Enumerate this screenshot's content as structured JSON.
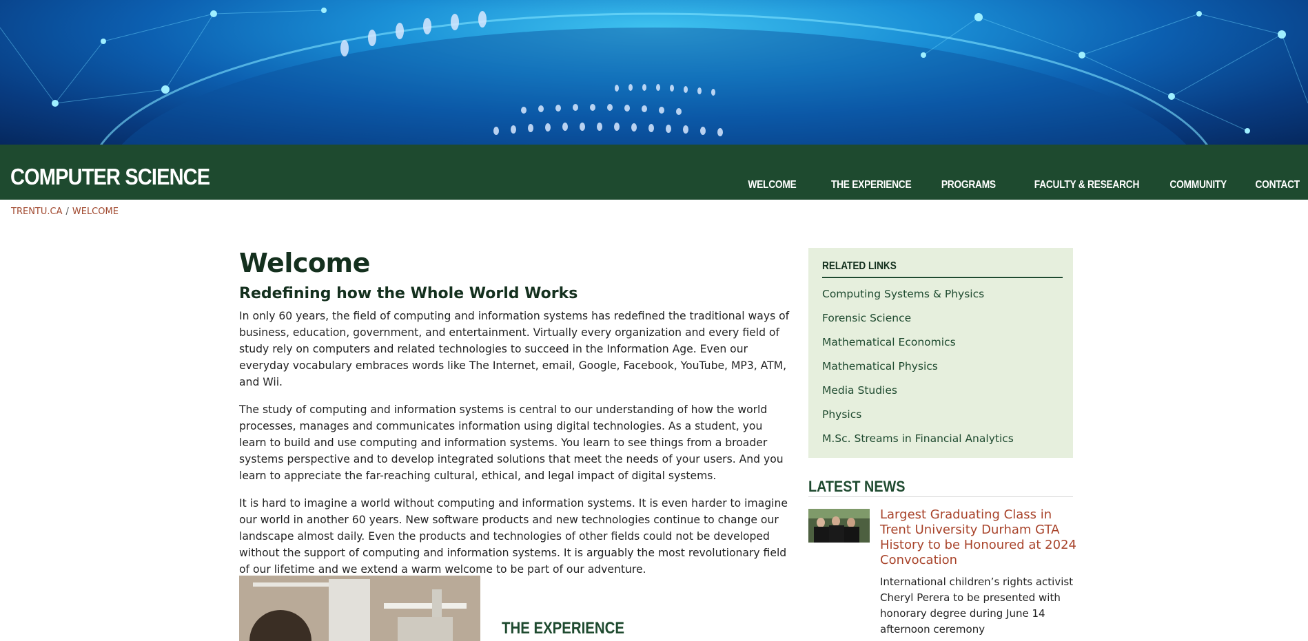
{
  "header": {
    "site_title": "COMPUTER SCIENCE",
    "nav": [
      {
        "label": "WELCOME"
      },
      {
        "label": "THE EXPERIENCE"
      },
      {
        "label": "PROGRAMS"
      },
      {
        "label": "FACULTY & RESEARCH"
      },
      {
        "label": "COMMUNITY"
      },
      {
        "label": "CONTACT"
      }
    ]
  },
  "breadcrumb": {
    "items": [
      "TRENTU.CA",
      "WELCOME"
    ],
    "separator": "/"
  },
  "main": {
    "title": "Welcome",
    "subtitle": "Redefining how the Whole World Works",
    "paragraphs": [
      "In only 60 years, the field of computing and information systems has redefined the traditional ways of business, education, government, and entertainment.  Virtually every organization and every field of study rely on computers and related technologies to succeed in the Information Age.  Even our everyday vocabulary embraces words like The Internet, email, Google, Facebook, YouTube, MP3, ATM, and Wii.",
      "The study of computing and information systems is central to our understanding of how the world processes, manages and communicates information using digital technologies.  As a student, you learn to build and use computing and information systems.  You learn to see things from a broader systems perspective and to develop integrated solutions that meet the needs of your users.  And you learn to appreciate the far-reaching cultural, ethical, and legal impact of digital systems.",
      "It is hard to imagine a world without computing and information systems.  It is even harder to imagine our world in another 60 years.  New software products and new technologies continue to change our landscape almost daily.  Even the products and technologies of other fields could not be developed without the support of computing and information systems.  It is arguably the most revolutionary field of our lifetime and we extend a warm welcome to be part of our adventure."
    ],
    "feature_title": "THE EXPERIENCE"
  },
  "sidebar": {
    "related_heading": "RELATED LINKS",
    "related_links": [
      "Computing Systems & Physics",
      "Forensic Science",
      "Mathematical Economics",
      "Mathematical Physics",
      "Media Studies",
      "Physics",
      "M.Sc. Streams in Financial Analytics"
    ],
    "news_heading": "LATEST NEWS",
    "news": {
      "title": "Largest Graduating Class in Trent University Durham GTA History to be Honoured at 2024 Convocation",
      "summary": "International children’s rights activist Cheryl Perera to be presented with honorary degree during June 14 afternoon ceremony"
    }
  },
  "colors": {
    "header_green": "#1e4a2f",
    "link_rust": "#a0482e",
    "sidebar_bg": "#e6efdd"
  }
}
